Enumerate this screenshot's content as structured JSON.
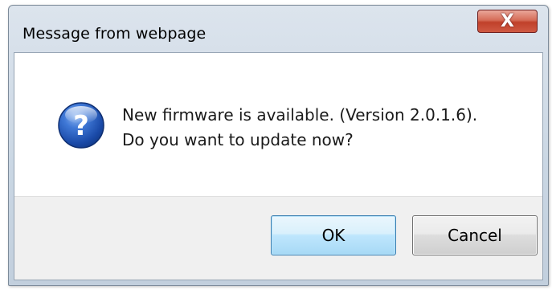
{
  "dialog": {
    "title": "Message from webpage",
    "close_glyph": "X",
    "icon": "question-icon",
    "message_lines": [
      "New firmware is available. (Version 2.0.1.6).",
      "Do you want to update now?"
    ],
    "buttons": {
      "ok_label": "OK",
      "cancel_label": "Cancel"
    }
  },
  "colors": {
    "close_button": "#c74a34",
    "ok_button_border": "#3c7fb1",
    "icon_blue": "#1f56b8"
  }
}
